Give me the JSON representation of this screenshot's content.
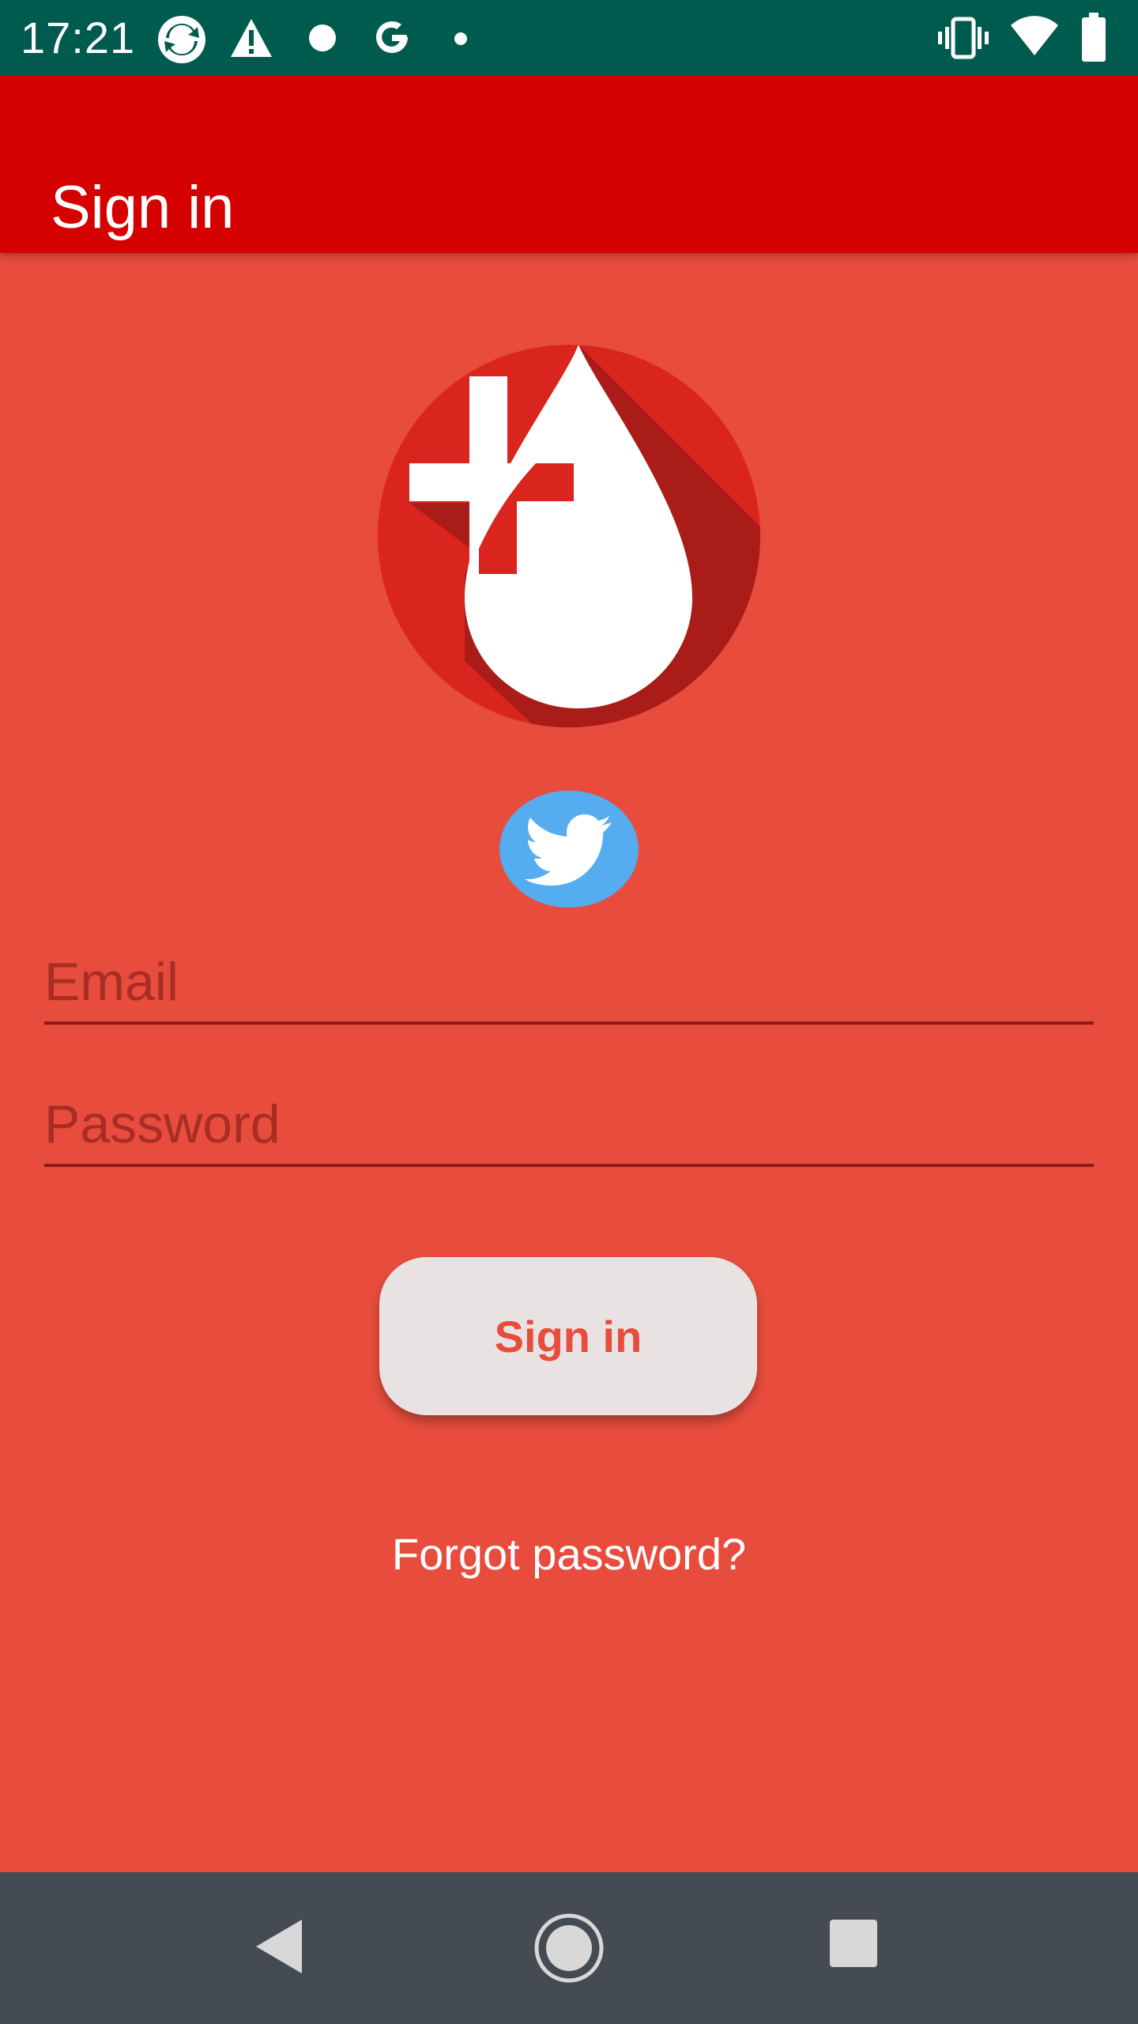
{
  "status_bar": {
    "time": "17:21",
    "left_icons": [
      "sync-app-icon",
      "warning-icon",
      "dot-icon",
      "google-icon",
      "small-dot-icon"
    ],
    "right_icons": [
      "vibrate-icon",
      "wifi-icon",
      "battery-icon"
    ],
    "background_color": "#005B4F"
  },
  "app_bar": {
    "title": "Sign in",
    "background_color": "#D50000"
  },
  "content": {
    "background_color": "#E74C3C",
    "logo_icon": "blood-drop-medical-cross-logo",
    "social": {
      "twitter_icon": "twitter-bird-icon",
      "twitter_color": "#55ACEE"
    },
    "email": {
      "placeholder": "Email",
      "value": ""
    },
    "password": {
      "placeholder": "Password",
      "value": ""
    },
    "sign_in_button": {
      "label": "Sign in"
    },
    "forgot_password": {
      "label": "Forgot password?"
    }
  },
  "nav_bar": {
    "buttons": [
      "back-icon",
      "home-icon",
      "recents-icon"
    ],
    "background_color": "#454B52"
  }
}
